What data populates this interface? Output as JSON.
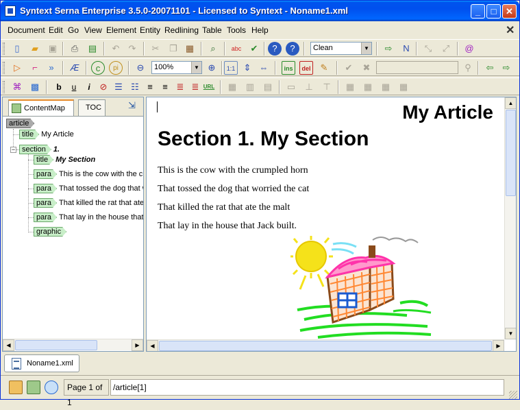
{
  "window": {
    "title": "Syntext Serna Enterprise 3.5.0-20071101 - Licensed to Syntext - Noname1.xml",
    "min_glyph": "_",
    "max_glyph": "□",
    "close_glyph": "✕"
  },
  "menu": [
    "Document",
    "Edit",
    "Go",
    "View",
    "Element",
    "Entity",
    "Redlining",
    "Table",
    "Tools",
    "Help"
  ],
  "toolbar": {
    "style_combo_value": "Clean",
    "zoom_combo_value": "100%",
    "format_bold": "b",
    "format_underline": "u",
    "format_italic": "i",
    "url_label": "URL",
    "ins_label": "ins",
    "del_label": "del",
    "onetoone_label": "1:1"
  },
  "left_panel": {
    "tabs": [
      "ContentMap",
      "TOC"
    ],
    "tree": [
      {
        "tag": "article",
        "text": ""
      },
      {
        "tag": "title",
        "text": "My Article"
      },
      {
        "tag": "section",
        "text": "1."
      },
      {
        "tag": "title",
        "text": "My Section"
      },
      {
        "tag": "para",
        "text": "This is the cow with the crumpled horn"
      },
      {
        "tag": "para",
        "text": "That tossed the dog that worried the cat"
      },
      {
        "tag": "para",
        "text": "That killed the rat that ate the malt"
      },
      {
        "tag": "para",
        "text": "That lay in the house that Jack built."
      },
      {
        "tag": "graphic",
        "text": ""
      }
    ],
    "expander": "−"
  },
  "document": {
    "article_title": "My Article",
    "section_title": "Section 1. My Section",
    "paragraphs": [
      "This is the cow with the crumpled horn",
      "That tossed the dog that worried the cat",
      "That killed the rat that ate the malt",
      "That lay in the house that Jack built."
    ]
  },
  "doc_tabs": [
    "Noname1.xml"
  ],
  "status": {
    "page": "Page 1 of 1",
    "xpath": "/article[1]"
  },
  "colors": {
    "titlebar": "#0054e3",
    "tag_fill": "#c8eec8",
    "tag_border": "#6aa86a",
    "sun": "#f5e21a",
    "house_roof": "#ff33aa",
    "house_wall": "#ff8833",
    "grass": "#22dd22"
  }
}
